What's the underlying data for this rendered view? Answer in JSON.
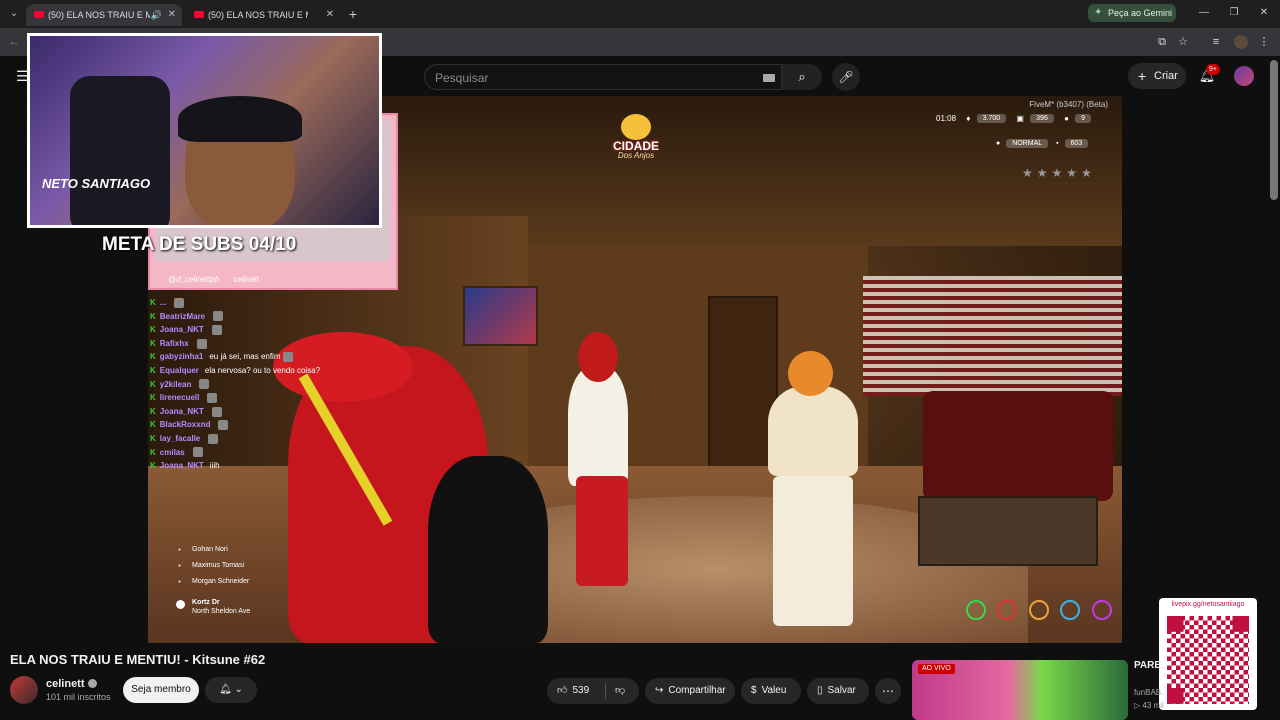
{
  "browser": {
    "tabs": [
      {
        "title": "(50) ELA NOS TRAIU E MENTIU! - Kitsune #62",
        "active": true,
        "audio": true
      },
      {
        "title": "(50) ELA NOS TRAIU E MENTIU! - Kitsune #62",
        "active": false,
        "audio": false
      }
    ],
    "new_tab_label": "+",
    "gemini_label": "Peça ao Gemini",
    "window_controls": [
      "—",
      "❐",
      "✕"
    ]
  },
  "youtube": {
    "search_placeholder": "Pesquisar",
    "create_label": "Criar",
    "notifications_count": "9+"
  },
  "stream": {
    "meta_subs": "META DE SUBS 04/10",
    "socials": [
      "@d_celinettpb",
      "celinett"
    ],
    "streamer_signature": "NETO SANTIAGO",
    "qr_label": "livepix.gg/netosantiiago",
    "server_logo": {
      "title": "CIDADE",
      "subtitle": "Dos Anjos"
    },
    "hud": {
      "build": "FiveM* (b3407) (Beta)",
      "clock": "01:08",
      "money": "3.700",
      "level": "396",
      "players": "9",
      "voice_mode": "NORMAL",
      "ping": "603"
    },
    "locations": [
      "Gohan Nori",
      "Maximus Tomasi",
      "Morgan Schneider"
    ],
    "gps": {
      "street": "Kortz Dr",
      "area": "North Sheldon Ave"
    },
    "chat": [
      {
        "user": "...",
        "message": ""
      },
      {
        "user": "BeatrizMare",
        "message": ""
      },
      {
        "user": "Joana_NKT",
        "message": ""
      },
      {
        "user": "Rafixhx",
        "message": ""
      },
      {
        "user": "gabyzinha1",
        "message": "eu já sei, mas enfim"
      },
      {
        "user": "Equalquer",
        "message": "ela nervosa? ou to vendo coisa?"
      },
      {
        "user": "y2kilean",
        "message": ""
      },
      {
        "user": "lirenecuell",
        "message": ""
      },
      {
        "user": "Joana_NKT",
        "message": ""
      },
      {
        "user": "BlackRoxxnd",
        "message": ""
      },
      {
        "user": "lay_facalle",
        "message": ""
      },
      {
        "user": "cmilas",
        "message": ""
      },
      {
        "user": "Joana_NKT",
        "message": "iiih"
      }
    ]
  },
  "video": {
    "title": "ELA NOS TRAIU E MENTIU! - Kitsune #62",
    "channel": "celinett",
    "subscribers": "101 mil inscritos",
    "member_label": "Seja membro",
    "likes": "539",
    "share_label": "Compartilhar",
    "thanks_label": "Valeu",
    "save_label": "Salvar"
  },
  "recommendation": {
    "live_badge": "AO VIVO",
    "title": "PARE... 12)",
    "channel": "funBAB...",
    "viewers": "▷ 43 mil"
  },
  "colors": {
    "accent_red": "#ff0033",
    "chat_username": "#b48cff",
    "chat_badge": "#39c93a"
  }
}
